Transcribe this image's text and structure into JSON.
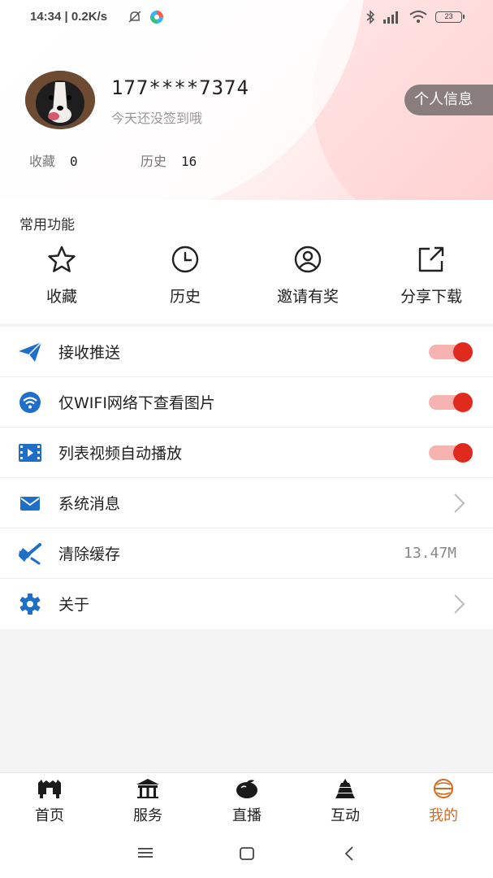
{
  "status": {
    "time": "14:34 | 0.2K/s",
    "battery": "23"
  },
  "profile": {
    "phone": "177****7374",
    "sign_tip": "今天还没签到哦",
    "info_button": "个人信息",
    "stats": [
      {
        "label": "收藏",
        "value": "0"
      },
      {
        "label": "历史",
        "value": "16"
      }
    ]
  },
  "common": {
    "title": "常用功能",
    "items": [
      {
        "label": "收藏",
        "icon": "star-icon"
      },
      {
        "label": "历史",
        "icon": "clock-icon"
      },
      {
        "label": "邀请有奖",
        "icon": "user-circle-icon"
      },
      {
        "label": "分享下载",
        "icon": "share-icon"
      }
    ]
  },
  "settings": [
    {
      "label": "接收推送",
      "icon": "paper-plane-icon",
      "control": "toggle",
      "on": true
    },
    {
      "label": "仅WIFI网络下查看图片",
      "icon": "wifi-icon",
      "control": "toggle",
      "on": true
    },
    {
      "label": "列表视频自动播放",
      "icon": "video-icon",
      "control": "toggle",
      "on": true
    },
    {
      "label": "系统消息",
      "icon": "mail-icon",
      "control": "arrow"
    },
    {
      "label": "清除缓存",
      "icon": "broom-icon",
      "control": "value",
      "value": "13.47M"
    },
    {
      "label": "关于",
      "icon": "gear-icon",
      "control": "arrow"
    }
  ],
  "tabs": [
    {
      "label": "首页",
      "icon": "home-gate-icon"
    },
    {
      "label": "服务",
      "icon": "pavilion-icon"
    },
    {
      "label": "直播",
      "icon": "fruit-icon"
    },
    {
      "label": "互动",
      "icon": "pagoda-icon"
    },
    {
      "label": "我的",
      "icon": "me-icon",
      "active": true
    }
  ],
  "colors": {
    "accent": "#e12a1e",
    "icon_blue": "#1f6fc9",
    "active_tab": "#d2691e"
  }
}
